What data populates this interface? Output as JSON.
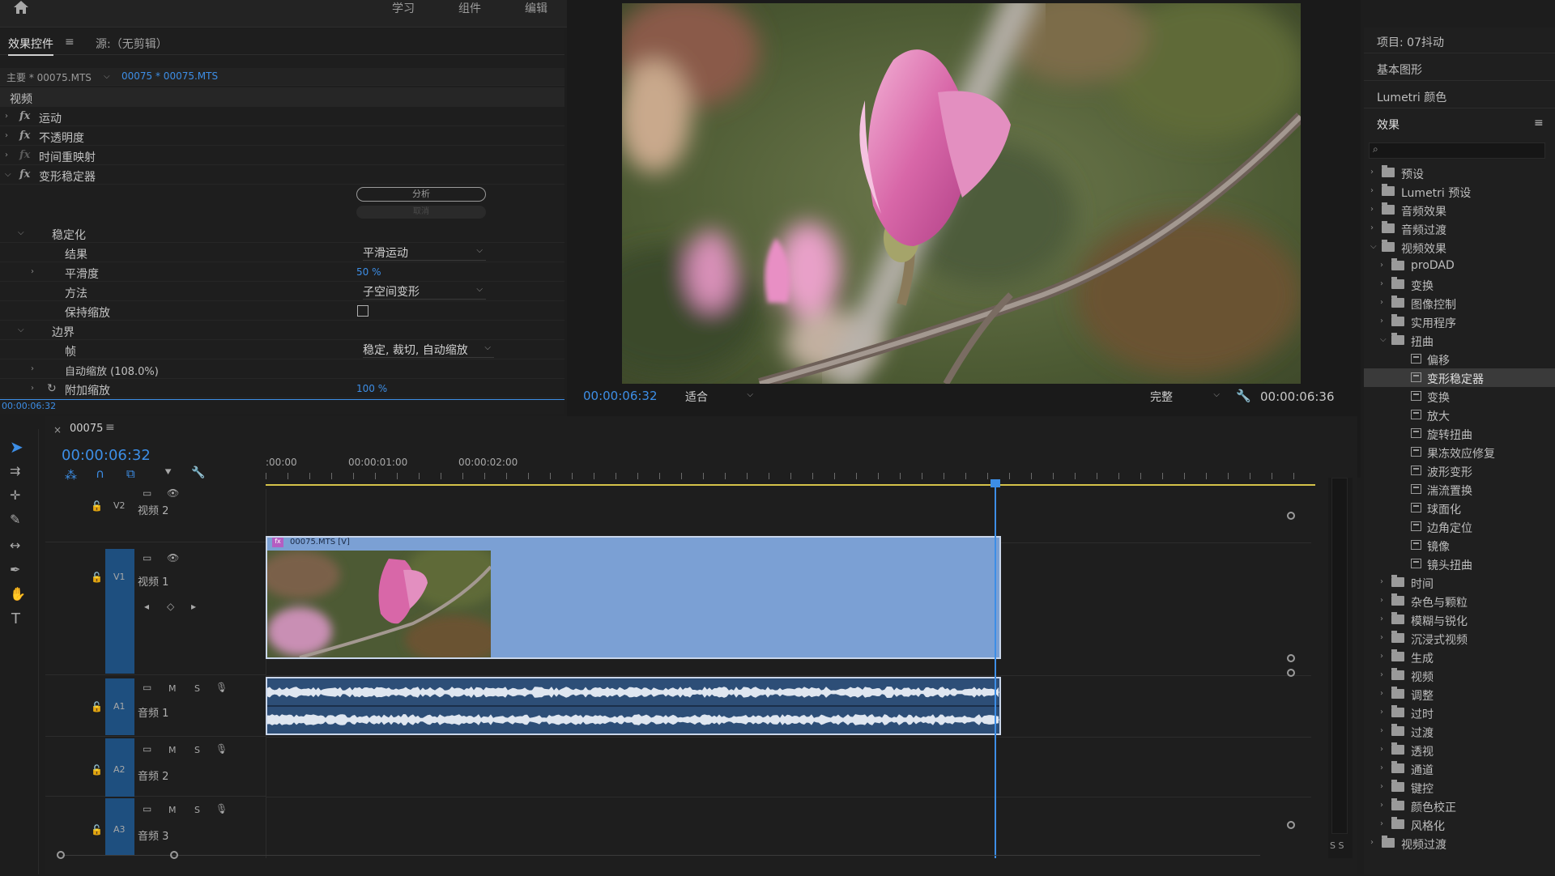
{
  "topbar": {
    "workspaces": [
      "学习",
      "组件",
      "编辑"
    ]
  },
  "effect_controls": {
    "tab_label": "效果控件",
    "source_label": "源:（无剪辑）",
    "master_clip": "主要 * 00075.MTS",
    "sequence_clip": "00075 * 00075.MTS",
    "section": "视频",
    "effects": [
      "运动",
      "不透明度",
      "时间重映射",
      "变形稳定器"
    ],
    "analyze_button": "分析",
    "cancel_button": "取消",
    "stabilization": {
      "label": "稳定化",
      "result_label": "结果",
      "result_value": "平滑运动",
      "smoothness_label": "平滑度",
      "smoothness_value": "50 %",
      "method_label": "方法",
      "method_value": "子空间变形",
      "preserve_scale_label": "保持缩放"
    },
    "borders": {
      "label": "边界",
      "framing_label": "帧",
      "framing_value": "稳定, 裁切, 自动缩放",
      "auto_scale_label": "自动缩放 (108.0%)",
      "additional_scale_label": "附加缩放",
      "additional_scale_value": "100 %"
    },
    "timecode": "00:00:06:32"
  },
  "program": {
    "timecode": "00:00:06:32",
    "fit_value": "适合",
    "quality_value": "完整",
    "duration": "00:00:06:36",
    "playhead_fraction": 0.98
  },
  "timeline": {
    "sequence_name": "00075",
    "timecode": "00:00:06:32",
    "ruler_labels": [
      ":00:00",
      "00:00:01:00",
      "00:00:02:00"
    ],
    "clip_label": "00075.MTS [V]",
    "tracks": [
      {
        "id": "V2",
        "name": "视频 2"
      },
      {
        "id": "V1",
        "name": "视频 1"
      },
      {
        "id": "A1",
        "name": "音频 1"
      },
      {
        "id": "A2",
        "name": "音频 2"
      },
      {
        "id": "A3",
        "name": "音频 3"
      }
    ],
    "audio_buttons": {
      "m": "M",
      "s": "S"
    },
    "meter_label": "S S"
  },
  "effects_panel": {
    "project_label": "项目: 07抖动",
    "essential_graphics": "基本图形",
    "lumetri_color": "Lumetri 颜色",
    "title": "效果",
    "tree": [
      {
        "label": "预设",
        "level": 0,
        "kind": "folder",
        "open": false
      },
      {
        "label": "Lumetri 预设",
        "level": 0,
        "kind": "folder",
        "open": false
      },
      {
        "label": "音频效果",
        "level": 0,
        "kind": "folder",
        "open": false
      },
      {
        "label": "音频过渡",
        "level": 0,
        "kind": "folder",
        "open": false
      },
      {
        "label": "视频效果",
        "level": 0,
        "kind": "folder",
        "open": true
      },
      {
        "label": "proDAD",
        "level": 1,
        "kind": "folder",
        "open": false
      },
      {
        "label": "变换",
        "level": 1,
        "kind": "folder",
        "open": false
      },
      {
        "label": "图像控制",
        "level": 1,
        "kind": "folder",
        "open": false
      },
      {
        "label": "实用程序",
        "level": 1,
        "kind": "folder",
        "open": false
      },
      {
        "label": "扭曲",
        "level": 1,
        "kind": "folder",
        "open": true
      },
      {
        "label": "偏移",
        "level": 2,
        "kind": "effect"
      },
      {
        "label": "变形稳定器",
        "level": 2,
        "kind": "effect",
        "selected": true
      },
      {
        "label": "变换",
        "level": 2,
        "kind": "effect"
      },
      {
        "label": "放大",
        "level": 2,
        "kind": "effect"
      },
      {
        "label": "旋转扭曲",
        "level": 2,
        "kind": "effect"
      },
      {
        "label": "果冻效应修复",
        "level": 2,
        "kind": "effect"
      },
      {
        "label": "波形变形",
        "level": 2,
        "kind": "effect"
      },
      {
        "label": "湍流置换",
        "level": 2,
        "kind": "effect"
      },
      {
        "label": "球面化",
        "level": 2,
        "kind": "effect"
      },
      {
        "label": "边角定位",
        "level": 2,
        "kind": "effect"
      },
      {
        "label": "镜像",
        "level": 2,
        "kind": "effect"
      },
      {
        "label": "镜头扭曲",
        "level": 2,
        "kind": "effect"
      },
      {
        "label": "时间",
        "level": 1,
        "kind": "folder",
        "open": false
      },
      {
        "label": "杂色与颗粒",
        "level": 1,
        "kind": "folder",
        "open": false
      },
      {
        "label": "模糊与锐化",
        "level": 1,
        "kind": "folder",
        "open": false
      },
      {
        "label": "沉浸式视频",
        "level": 1,
        "kind": "folder",
        "open": false
      },
      {
        "label": "生成",
        "level": 1,
        "kind": "folder",
        "open": false
      },
      {
        "label": "视频",
        "level": 1,
        "kind": "folder",
        "open": false
      },
      {
        "label": "调整",
        "level": 1,
        "kind": "folder",
        "open": false
      },
      {
        "label": "过时",
        "level": 1,
        "kind": "folder",
        "open": false
      },
      {
        "label": "过渡",
        "level": 1,
        "kind": "folder",
        "open": false
      },
      {
        "label": "透视",
        "level": 1,
        "kind": "folder",
        "open": false
      },
      {
        "label": "通道",
        "level": 1,
        "kind": "folder",
        "open": false
      },
      {
        "label": "键控",
        "level": 1,
        "kind": "folder",
        "open": false
      },
      {
        "label": "颜色校正",
        "level": 1,
        "kind": "folder",
        "open": false
      },
      {
        "label": "风格化",
        "level": 1,
        "kind": "folder",
        "open": false
      },
      {
        "label": "视频过渡",
        "level": 0,
        "kind": "folder",
        "open": false
      }
    ]
  },
  "colors": {
    "accent": "#3d8ee6",
    "clip_blue": "#7ba0d4",
    "track_blue": "#1e4f7f"
  }
}
